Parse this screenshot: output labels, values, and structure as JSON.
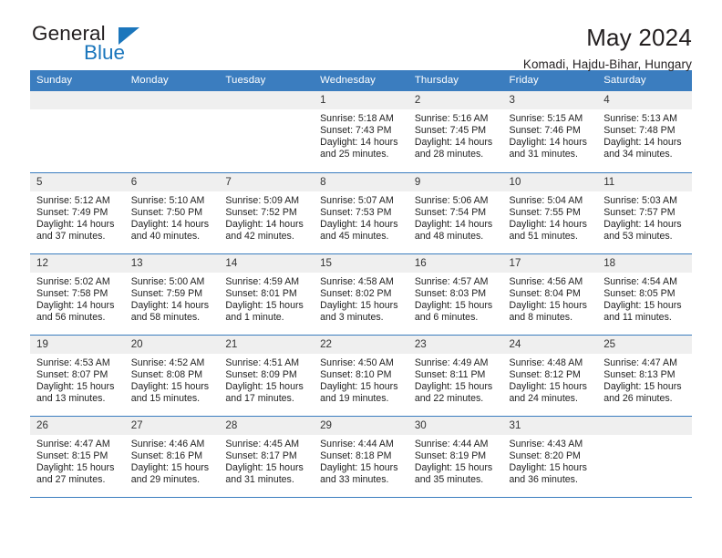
{
  "brand": {
    "line1": "General",
    "line2": "Blue",
    "accent_color": "#1b76bc"
  },
  "header": {
    "title": "May 2024",
    "location": "Komadi, Hajdu-Bihar, Hungary"
  },
  "theme": {
    "header_row_bg": "#3b7dbf",
    "header_row_text": "#ffffff",
    "daynum_bg": "#efefef",
    "cell_border": "#3b7dbf"
  },
  "calendar": {
    "weekday_headers": [
      "Sunday",
      "Monday",
      "Tuesday",
      "Wednesday",
      "Thursday",
      "Friday",
      "Saturday"
    ],
    "weeks": [
      [
        {
          "day": "",
          "empty": true
        },
        {
          "day": "",
          "empty": true
        },
        {
          "day": "",
          "empty": true
        },
        {
          "day": "1",
          "sunrise": "Sunrise: 5:18 AM",
          "sunset": "Sunset: 7:43 PM",
          "daylight": "Daylight: 14 hours and 25 minutes."
        },
        {
          "day": "2",
          "sunrise": "Sunrise: 5:16 AM",
          "sunset": "Sunset: 7:45 PM",
          "daylight": "Daylight: 14 hours and 28 minutes."
        },
        {
          "day": "3",
          "sunrise": "Sunrise: 5:15 AM",
          "sunset": "Sunset: 7:46 PM",
          "daylight": "Daylight: 14 hours and 31 minutes."
        },
        {
          "day": "4",
          "sunrise": "Sunrise: 5:13 AM",
          "sunset": "Sunset: 7:48 PM",
          "daylight": "Daylight: 14 hours and 34 minutes."
        }
      ],
      [
        {
          "day": "5",
          "sunrise": "Sunrise: 5:12 AM",
          "sunset": "Sunset: 7:49 PM",
          "daylight": "Daylight: 14 hours and 37 minutes."
        },
        {
          "day": "6",
          "sunrise": "Sunrise: 5:10 AM",
          "sunset": "Sunset: 7:50 PM",
          "daylight": "Daylight: 14 hours and 40 minutes."
        },
        {
          "day": "7",
          "sunrise": "Sunrise: 5:09 AM",
          "sunset": "Sunset: 7:52 PM",
          "daylight": "Daylight: 14 hours and 42 minutes."
        },
        {
          "day": "8",
          "sunrise": "Sunrise: 5:07 AM",
          "sunset": "Sunset: 7:53 PM",
          "daylight": "Daylight: 14 hours and 45 minutes."
        },
        {
          "day": "9",
          "sunrise": "Sunrise: 5:06 AM",
          "sunset": "Sunset: 7:54 PM",
          "daylight": "Daylight: 14 hours and 48 minutes."
        },
        {
          "day": "10",
          "sunrise": "Sunrise: 5:04 AM",
          "sunset": "Sunset: 7:55 PM",
          "daylight": "Daylight: 14 hours and 51 minutes."
        },
        {
          "day": "11",
          "sunrise": "Sunrise: 5:03 AM",
          "sunset": "Sunset: 7:57 PM",
          "daylight": "Daylight: 14 hours and 53 minutes."
        }
      ],
      [
        {
          "day": "12",
          "sunrise": "Sunrise: 5:02 AM",
          "sunset": "Sunset: 7:58 PM",
          "daylight": "Daylight: 14 hours and 56 minutes."
        },
        {
          "day": "13",
          "sunrise": "Sunrise: 5:00 AM",
          "sunset": "Sunset: 7:59 PM",
          "daylight": "Daylight: 14 hours and 58 minutes."
        },
        {
          "day": "14",
          "sunrise": "Sunrise: 4:59 AM",
          "sunset": "Sunset: 8:01 PM",
          "daylight": "Daylight: 15 hours and 1 minute."
        },
        {
          "day": "15",
          "sunrise": "Sunrise: 4:58 AM",
          "sunset": "Sunset: 8:02 PM",
          "daylight": "Daylight: 15 hours and 3 minutes."
        },
        {
          "day": "16",
          "sunrise": "Sunrise: 4:57 AM",
          "sunset": "Sunset: 8:03 PM",
          "daylight": "Daylight: 15 hours and 6 minutes."
        },
        {
          "day": "17",
          "sunrise": "Sunrise: 4:56 AM",
          "sunset": "Sunset: 8:04 PM",
          "daylight": "Daylight: 15 hours and 8 minutes."
        },
        {
          "day": "18",
          "sunrise": "Sunrise: 4:54 AM",
          "sunset": "Sunset: 8:05 PM",
          "daylight": "Daylight: 15 hours and 11 minutes."
        }
      ],
      [
        {
          "day": "19",
          "sunrise": "Sunrise: 4:53 AM",
          "sunset": "Sunset: 8:07 PM",
          "daylight": "Daylight: 15 hours and 13 minutes."
        },
        {
          "day": "20",
          "sunrise": "Sunrise: 4:52 AM",
          "sunset": "Sunset: 8:08 PM",
          "daylight": "Daylight: 15 hours and 15 minutes."
        },
        {
          "day": "21",
          "sunrise": "Sunrise: 4:51 AM",
          "sunset": "Sunset: 8:09 PM",
          "daylight": "Daylight: 15 hours and 17 minutes."
        },
        {
          "day": "22",
          "sunrise": "Sunrise: 4:50 AM",
          "sunset": "Sunset: 8:10 PM",
          "daylight": "Daylight: 15 hours and 19 minutes."
        },
        {
          "day": "23",
          "sunrise": "Sunrise: 4:49 AM",
          "sunset": "Sunset: 8:11 PM",
          "daylight": "Daylight: 15 hours and 22 minutes."
        },
        {
          "day": "24",
          "sunrise": "Sunrise: 4:48 AM",
          "sunset": "Sunset: 8:12 PM",
          "daylight": "Daylight: 15 hours and 24 minutes."
        },
        {
          "day": "25",
          "sunrise": "Sunrise: 4:47 AM",
          "sunset": "Sunset: 8:13 PM",
          "daylight": "Daylight: 15 hours and 26 minutes."
        }
      ],
      [
        {
          "day": "26",
          "sunrise": "Sunrise: 4:47 AM",
          "sunset": "Sunset: 8:15 PM",
          "daylight": "Daylight: 15 hours and 27 minutes."
        },
        {
          "day": "27",
          "sunrise": "Sunrise: 4:46 AM",
          "sunset": "Sunset: 8:16 PM",
          "daylight": "Daylight: 15 hours and 29 minutes."
        },
        {
          "day": "28",
          "sunrise": "Sunrise: 4:45 AM",
          "sunset": "Sunset: 8:17 PM",
          "daylight": "Daylight: 15 hours and 31 minutes."
        },
        {
          "day": "29",
          "sunrise": "Sunrise: 4:44 AM",
          "sunset": "Sunset: 8:18 PM",
          "daylight": "Daylight: 15 hours and 33 minutes."
        },
        {
          "day": "30",
          "sunrise": "Sunrise: 4:44 AM",
          "sunset": "Sunset: 8:19 PM",
          "daylight": "Daylight: 15 hours and 35 minutes."
        },
        {
          "day": "31",
          "sunrise": "Sunrise: 4:43 AM",
          "sunset": "Sunset: 8:20 PM",
          "daylight": "Daylight: 15 hours and 36 minutes."
        },
        {
          "day": "",
          "empty": true
        }
      ]
    ]
  }
}
